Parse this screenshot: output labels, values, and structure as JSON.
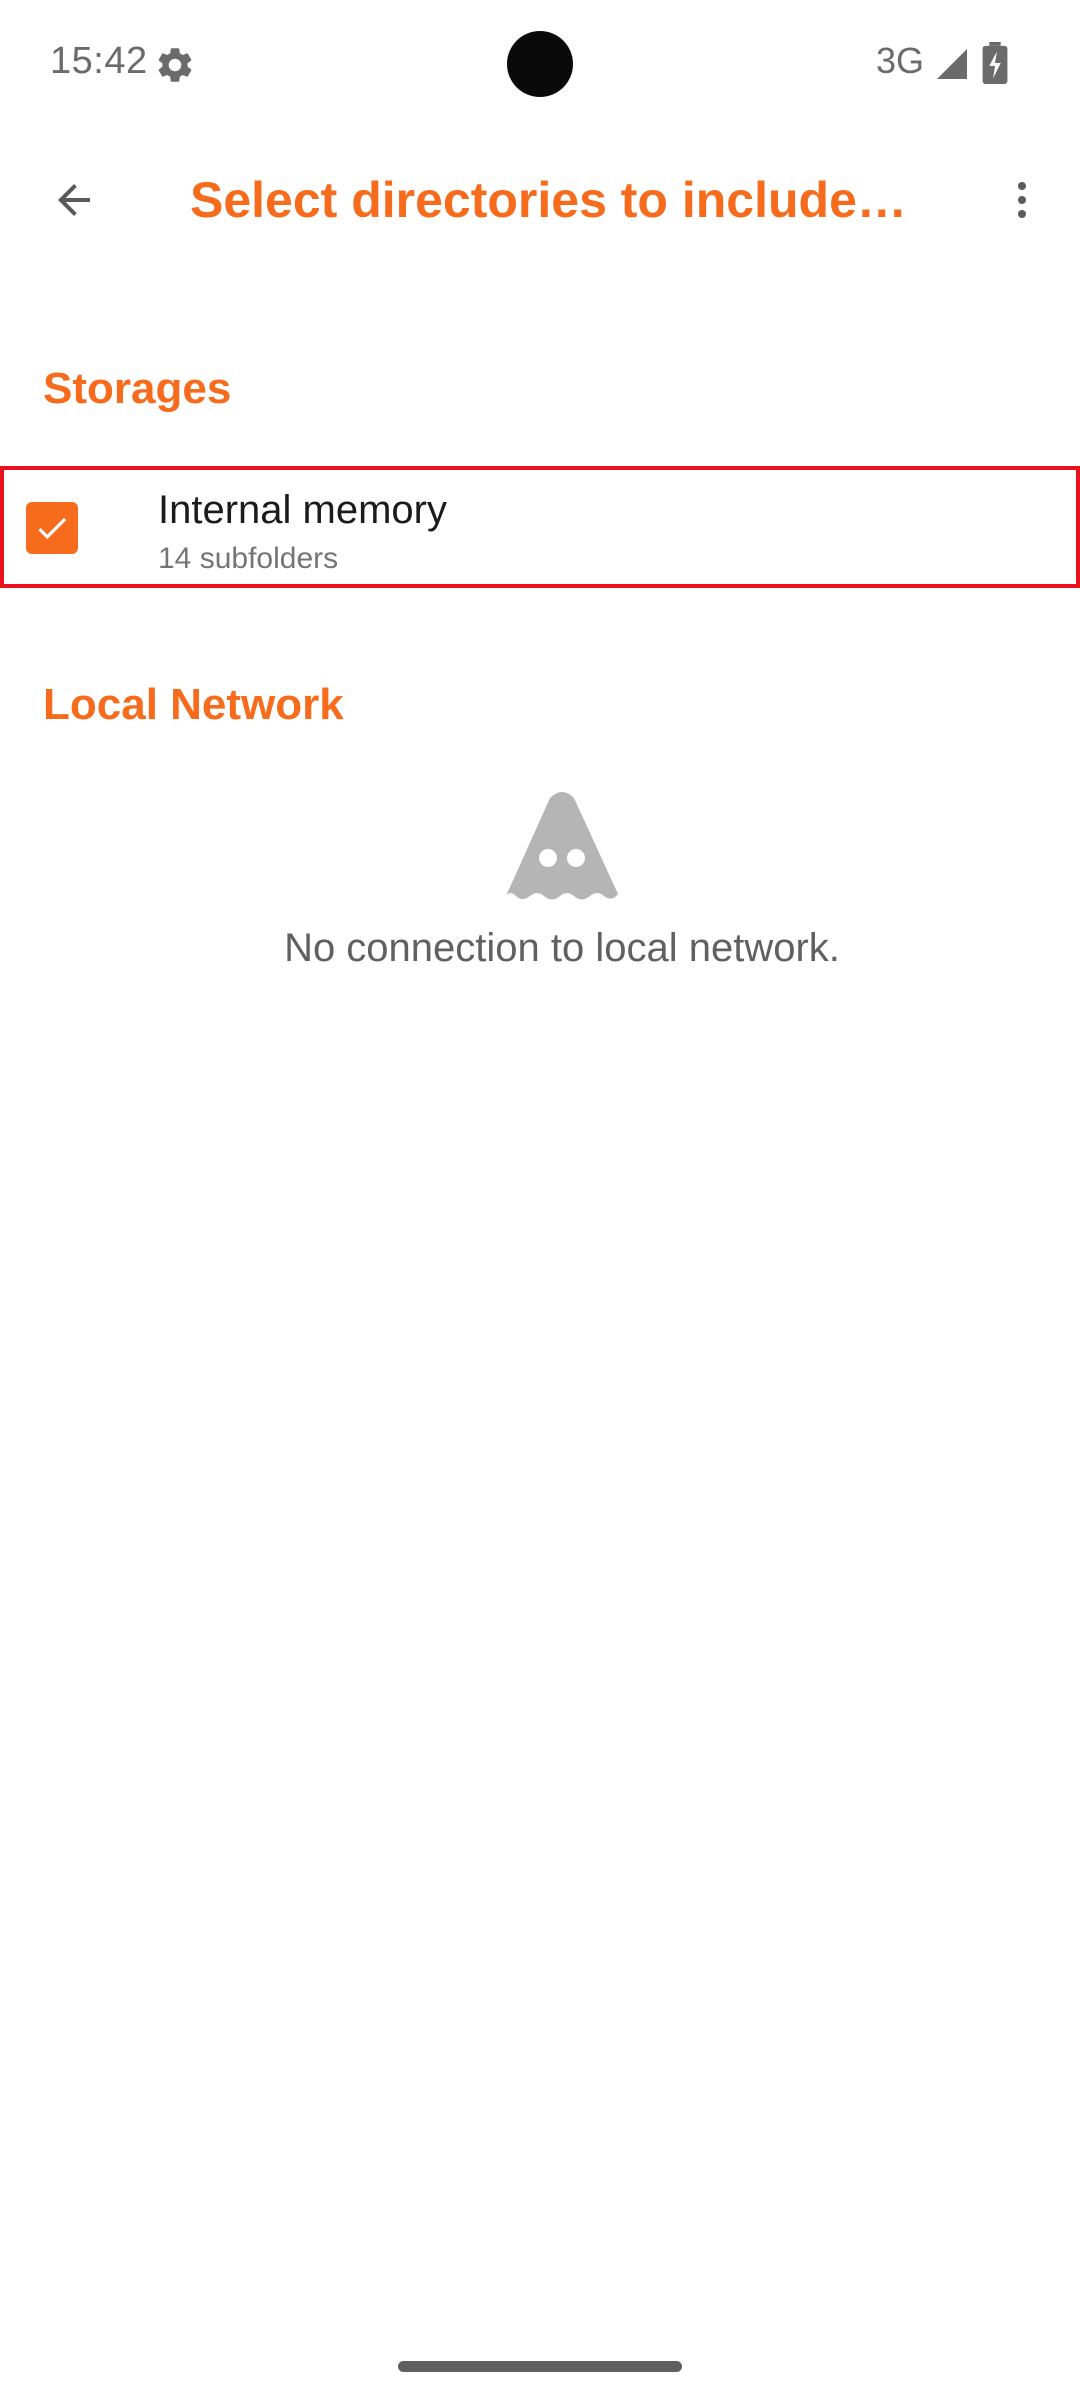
{
  "status_bar": {
    "time": "15:42",
    "network": "3G",
    "icons": [
      "gear-icon",
      "signal-icon",
      "battery-charging-icon"
    ]
  },
  "app_bar": {
    "title": "Select directories to include…",
    "back_icon": "arrow-back-icon",
    "menu_icon": "more-vert-icon"
  },
  "sections": {
    "storages": {
      "header": "Storages",
      "items": [
        {
          "title": "Internal memory",
          "subtitle": "14 subfolders",
          "checked": true
        }
      ]
    },
    "local_network": {
      "header": "Local Network",
      "empty_icon": "vlc-ghost-cone-icon",
      "empty_text": "No connection to local network."
    }
  },
  "colors": {
    "accent": "#f76b1c",
    "highlight_border": "#e8111c",
    "muted_text": "#757575",
    "icon_gray": "#b5b5b5"
  }
}
